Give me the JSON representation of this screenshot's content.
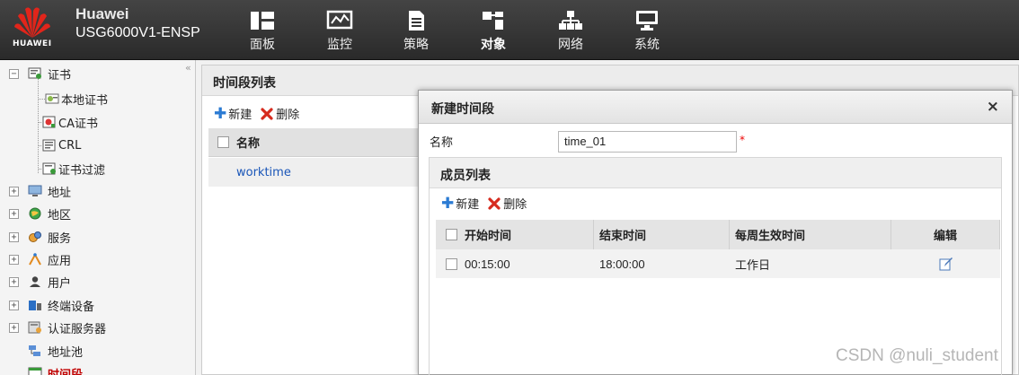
{
  "header": {
    "logo_text": "HUAWEI",
    "brand": "Huawei",
    "device": "USG6000V1-ENSP",
    "nav": [
      {
        "label": "面板",
        "icon": "dashboard-icon"
      },
      {
        "label": "监控",
        "icon": "monitor-chart-icon"
      },
      {
        "label": "策略",
        "icon": "policy-document-icon"
      },
      {
        "label": "对象",
        "icon": "object-icon",
        "active": true
      },
      {
        "label": "网络",
        "icon": "network-topology-icon"
      },
      {
        "label": "系统",
        "icon": "system-computer-icon"
      }
    ]
  },
  "sidebar": {
    "collapse_glyph": "«",
    "root": {
      "label": "证书",
      "toggle": "−"
    },
    "cert_children": [
      "本地证书",
      "CA证书",
      "CRL",
      "证书过滤"
    ],
    "items": [
      {
        "label": "地址",
        "toggle": "+"
      },
      {
        "label": "地区",
        "toggle": "+"
      },
      {
        "label": "服务",
        "toggle": "+"
      },
      {
        "label": "应用",
        "toggle": "+"
      },
      {
        "label": "用户",
        "toggle": "+"
      },
      {
        "label": "终端设备",
        "toggle": "+"
      },
      {
        "label": "认证服务器",
        "toggle": "+"
      },
      {
        "label": "地址池"
      },
      {
        "label": "时间段",
        "selected": true
      }
    ]
  },
  "main": {
    "title": "时间段列表",
    "toolbar": {
      "new_label": "新建",
      "delete_label": "删除"
    },
    "column_name": "名称",
    "rows": [
      "worktime"
    ]
  },
  "dialog": {
    "title": "新建时间段",
    "close_glyph": "×",
    "name_label": "名称",
    "name_value": "time_01",
    "required_mark": "*",
    "members_title": "成员列表",
    "toolbar": {
      "new_label": "新建",
      "delete_label": "删除"
    },
    "columns": [
      "开始时间",
      "结束时间",
      "每周生效时间",
      "编辑"
    ],
    "rows": [
      {
        "start": "00:15:00",
        "end": "18:00:00",
        "week": "工作日"
      }
    ]
  },
  "watermark": "CSDN @nuli_student"
}
